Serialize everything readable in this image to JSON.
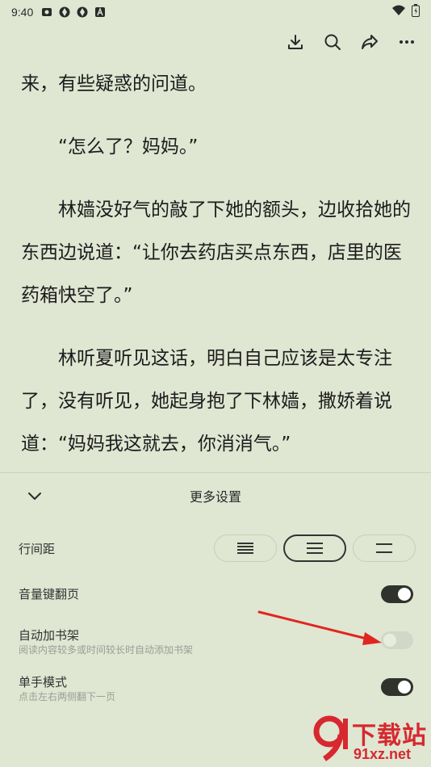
{
  "status_bar": {
    "time": "9:40",
    "icons": [
      "photo-icon",
      "app-icon",
      "app-icon",
      "a-icon"
    ],
    "right_icons": [
      "wifi-icon",
      "battery-icon"
    ]
  },
  "toolbar": {
    "icons": [
      "download-icon",
      "search-icon",
      "share-icon",
      "more-icon"
    ]
  },
  "reader": {
    "paragraphs": [
      "来，有些疑惑的问道。",
      "“怎么了？妈妈。”",
      "林嫱没好气的敲了下她的额头，边收拾她的东西边说道：“让你去药店买点东西，店里的医药箱快空了。”",
      "林听夏听见这话，明白自己应该是太专注了，没有听见，她起身抱了下林嫱，撒娇着说道：“妈妈我这就去，你消消气。”"
    ]
  },
  "panel": {
    "title": "更多设置",
    "line_spacing": {
      "label": "行间距",
      "selected_index": 1
    },
    "volume_key": {
      "label": "音量键翻页",
      "enabled": true
    },
    "auto_shelf": {
      "label": "自动加书架",
      "sub": "阅读内容较多或时间较长时自动添加书架",
      "enabled": false
    },
    "one_hand": {
      "label": "单手模式",
      "sub": "点击左右两侧翻下一页",
      "enabled": true
    }
  },
  "watermark": {
    "brand": "下载站",
    "url": "91xz.net"
  },
  "colors": {
    "background": "#dfe6d2",
    "toggle_on": "#2f332c",
    "arrow": "#e0261f",
    "brand": "#d7282f"
  }
}
